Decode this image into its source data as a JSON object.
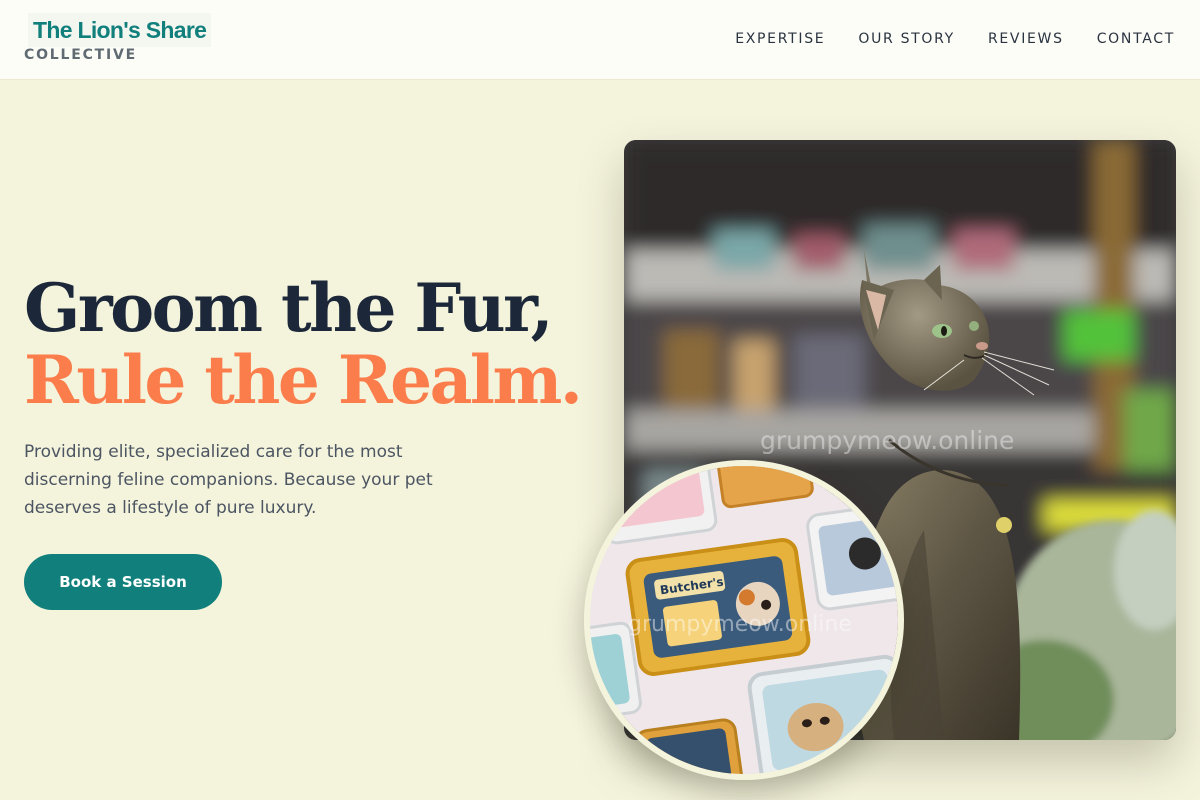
{
  "brand": {
    "title": "The Lion's Share",
    "subtitle": "COLLECTIVE"
  },
  "nav": {
    "items": [
      "EXPERTISE",
      "OUR STORY",
      "REVIEWS",
      "CONTACT"
    ]
  },
  "hero": {
    "headline_line1": "Groom the Fur,",
    "headline_line2": "Rule the Realm.",
    "description": "Providing elite, specialized care for the most discerning feline companions. Because your pet deserves a lifestyle of pure luxury.",
    "cta_label": "Book a Session"
  },
  "images": {
    "main_watermark": "grumpymeow.online",
    "food_watermark": "grumpymeow.online",
    "food_brand_text": "Butcher's"
  },
  "colors": {
    "background": "#f4f3dc",
    "header_background": "#fdfdf8",
    "brand_teal": "#11807d",
    "headline_dark": "#1c2839",
    "accent_orange": "#fb7d4c",
    "body_text": "#4c5562"
  }
}
